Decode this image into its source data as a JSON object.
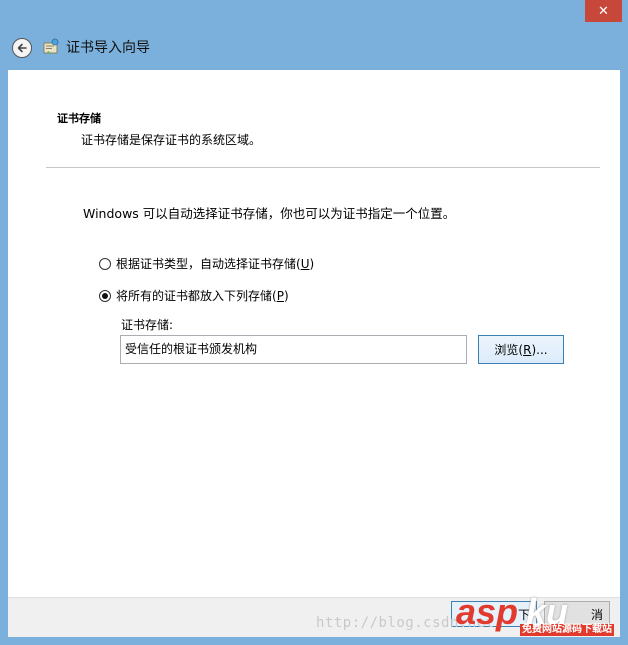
{
  "window": {
    "close_glyph": "✕",
    "title": "证书导入向导",
    "colors": {
      "frame": "#7ab0db",
      "close": "#c7473a",
      "content": "#ffffff"
    }
  },
  "section": {
    "title": "证书存储",
    "description": "证书存储是保存证书的系统区域。"
  },
  "intro": "Windows 可以自动选择证书存储，你也可以为证书指定一个位置。",
  "options": [
    {
      "label": "根据证书类型，自动选择证书存储(",
      "accel": "U",
      "suffix": ")",
      "selected": false
    },
    {
      "label": "将所有的证书都放入下列存储(",
      "accel": "P",
      "suffix": ")",
      "selected": true
    }
  ],
  "store": {
    "label": "证书存储:",
    "value": "受信任的根证书颁发机构",
    "browse_label_pre": "浏览(",
    "browse_accel": "R",
    "browse_label_post": ")..."
  },
  "footer": {
    "next_label": "下",
    "cancel_label": "消"
  },
  "watermark": {
    "blog": "http://blog.csdn.net/",
    "logo_a": "asp",
    "logo_b": "ku",
    "logo_sub": "免费网站源码下载站"
  }
}
